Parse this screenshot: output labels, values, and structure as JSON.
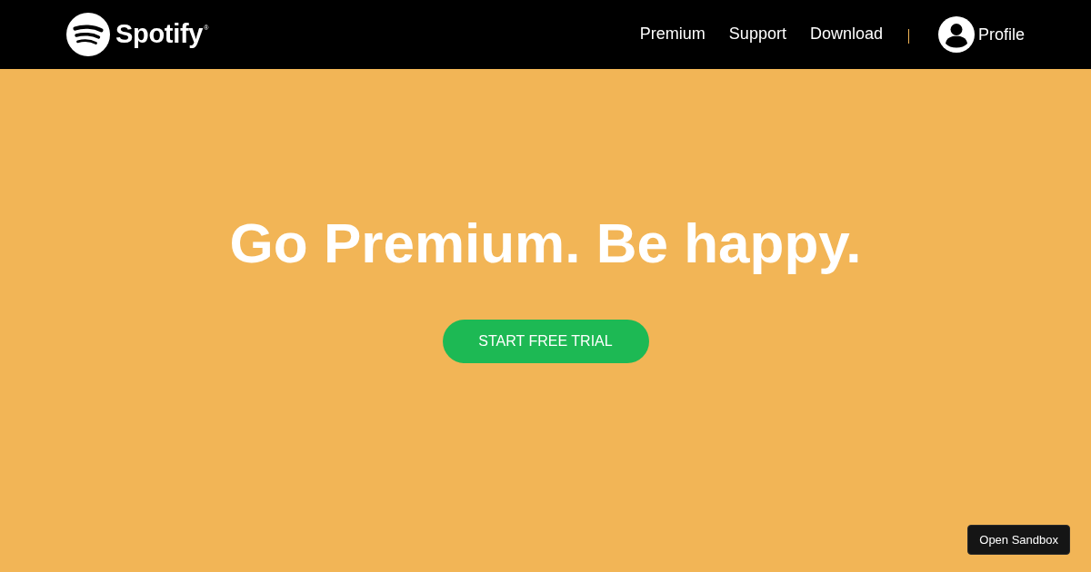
{
  "header": {
    "logo": {
      "wordmark": "Spotify$^{®}$"
    },
    "nav": [
      {
        "label": "Premium"
      },
      {
        "label": "Support"
      },
      {
        "label": "Download"
      }
    ],
    "profile": {
      "label": "Profile"
    }
  },
  "hero": {
    "headline": "Go Premium. Be happy.",
    "cta": "START FREE TRIAL"
  },
  "sandbox_button": "Open Sandbox"
}
